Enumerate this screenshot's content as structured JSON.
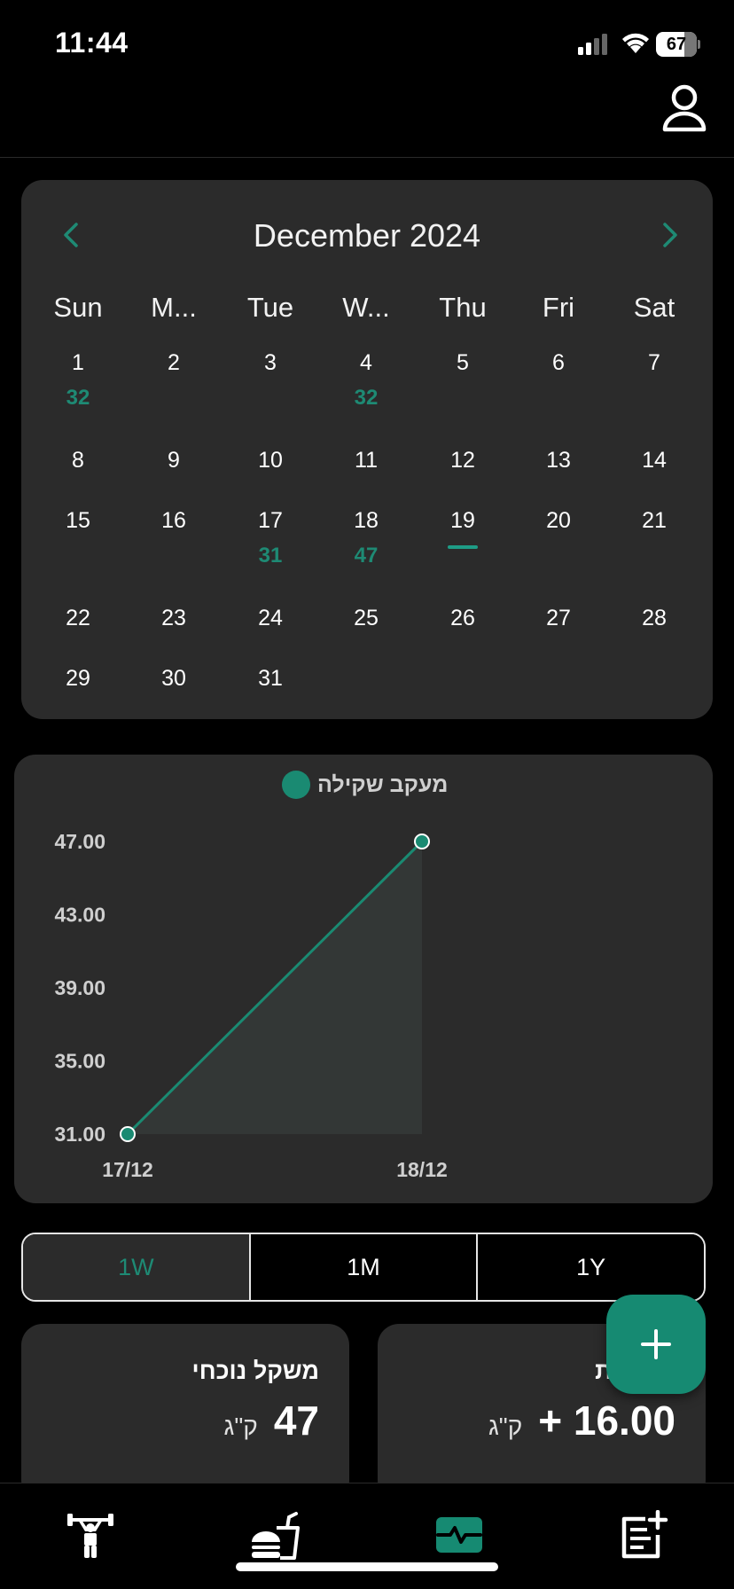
{
  "status_bar": {
    "time": "11:44",
    "battery": "67"
  },
  "calendar": {
    "title": "December 2024",
    "weekdays": [
      "Sun",
      "M...",
      "Tue",
      "W...",
      "Thu",
      "Fri",
      "Sat"
    ],
    "weeks": [
      [
        {
          "d": "1",
          "w": "32"
        },
        {
          "d": "2",
          "w": ""
        },
        {
          "d": "3",
          "w": ""
        },
        {
          "d": "4",
          "w": "32"
        },
        {
          "d": "5",
          "w": ""
        },
        {
          "d": "6",
          "w": ""
        },
        {
          "d": "7",
          "w": ""
        }
      ],
      [
        {
          "d": "8",
          "w": ""
        },
        {
          "d": "9",
          "w": ""
        },
        {
          "d": "10",
          "w": ""
        },
        {
          "d": "11",
          "w": ""
        },
        {
          "d": "12",
          "w": ""
        },
        {
          "d": "13",
          "w": ""
        },
        {
          "d": "14",
          "w": ""
        }
      ],
      [
        {
          "d": "15",
          "w": ""
        },
        {
          "d": "16",
          "w": ""
        },
        {
          "d": "17",
          "w": "31"
        },
        {
          "d": "18",
          "w": "47"
        },
        {
          "d": "19",
          "w": "",
          "today": true
        },
        {
          "d": "20",
          "w": ""
        },
        {
          "d": "21",
          "w": ""
        }
      ],
      [
        {
          "d": "22",
          "w": ""
        },
        {
          "d": "23",
          "w": ""
        },
        {
          "d": "24",
          "w": ""
        },
        {
          "d": "25",
          "w": ""
        },
        {
          "d": "26",
          "w": ""
        },
        {
          "d": "27",
          "w": ""
        },
        {
          "d": "28",
          "w": ""
        }
      ],
      [
        {
          "d": "29",
          "w": ""
        },
        {
          "d": "30",
          "w": ""
        },
        {
          "d": "31",
          "w": ""
        }
      ]
    ]
  },
  "chart_data": {
    "type": "line",
    "title": "",
    "series": [
      {
        "name": "מעקב שקילה",
        "color": "#1a8a72",
        "values": [
          31,
          47
        ]
      }
    ],
    "x": [
      "17/12",
      "18/12"
    ],
    "y_ticks": [
      "47.00",
      "43.00",
      "39.00",
      "35.00",
      "31.00"
    ],
    "ylim": [
      31,
      47
    ],
    "xlabel": "",
    "ylabel": "",
    "grid": false,
    "legend": "top-center"
  },
  "range_selector": {
    "options": [
      "1W",
      "1M",
      "1Y"
    ],
    "active": "1W"
  },
  "stats": {
    "current_weight": {
      "title": "משקל נוכחי",
      "value": "47",
      "unit": "ק\"ג"
    },
    "weekly_change": {
      "title": "שבועית",
      "value": "+ 16.00",
      "unit": "ק\"ג"
    }
  },
  "icons": {
    "profile": "person-outline-icon",
    "prev": "chevron-left-icon",
    "next": "chevron-right-icon",
    "fab": "plus-icon",
    "tabs": [
      "weightlifter-icon",
      "food-drink-icon",
      "activity-monitor-icon",
      "note-add-icon"
    ]
  },
  "colors": {
    "accent": "#1a8a72",
    "card": "#2b2b2b",
    "background": "#000000"
  }
}
